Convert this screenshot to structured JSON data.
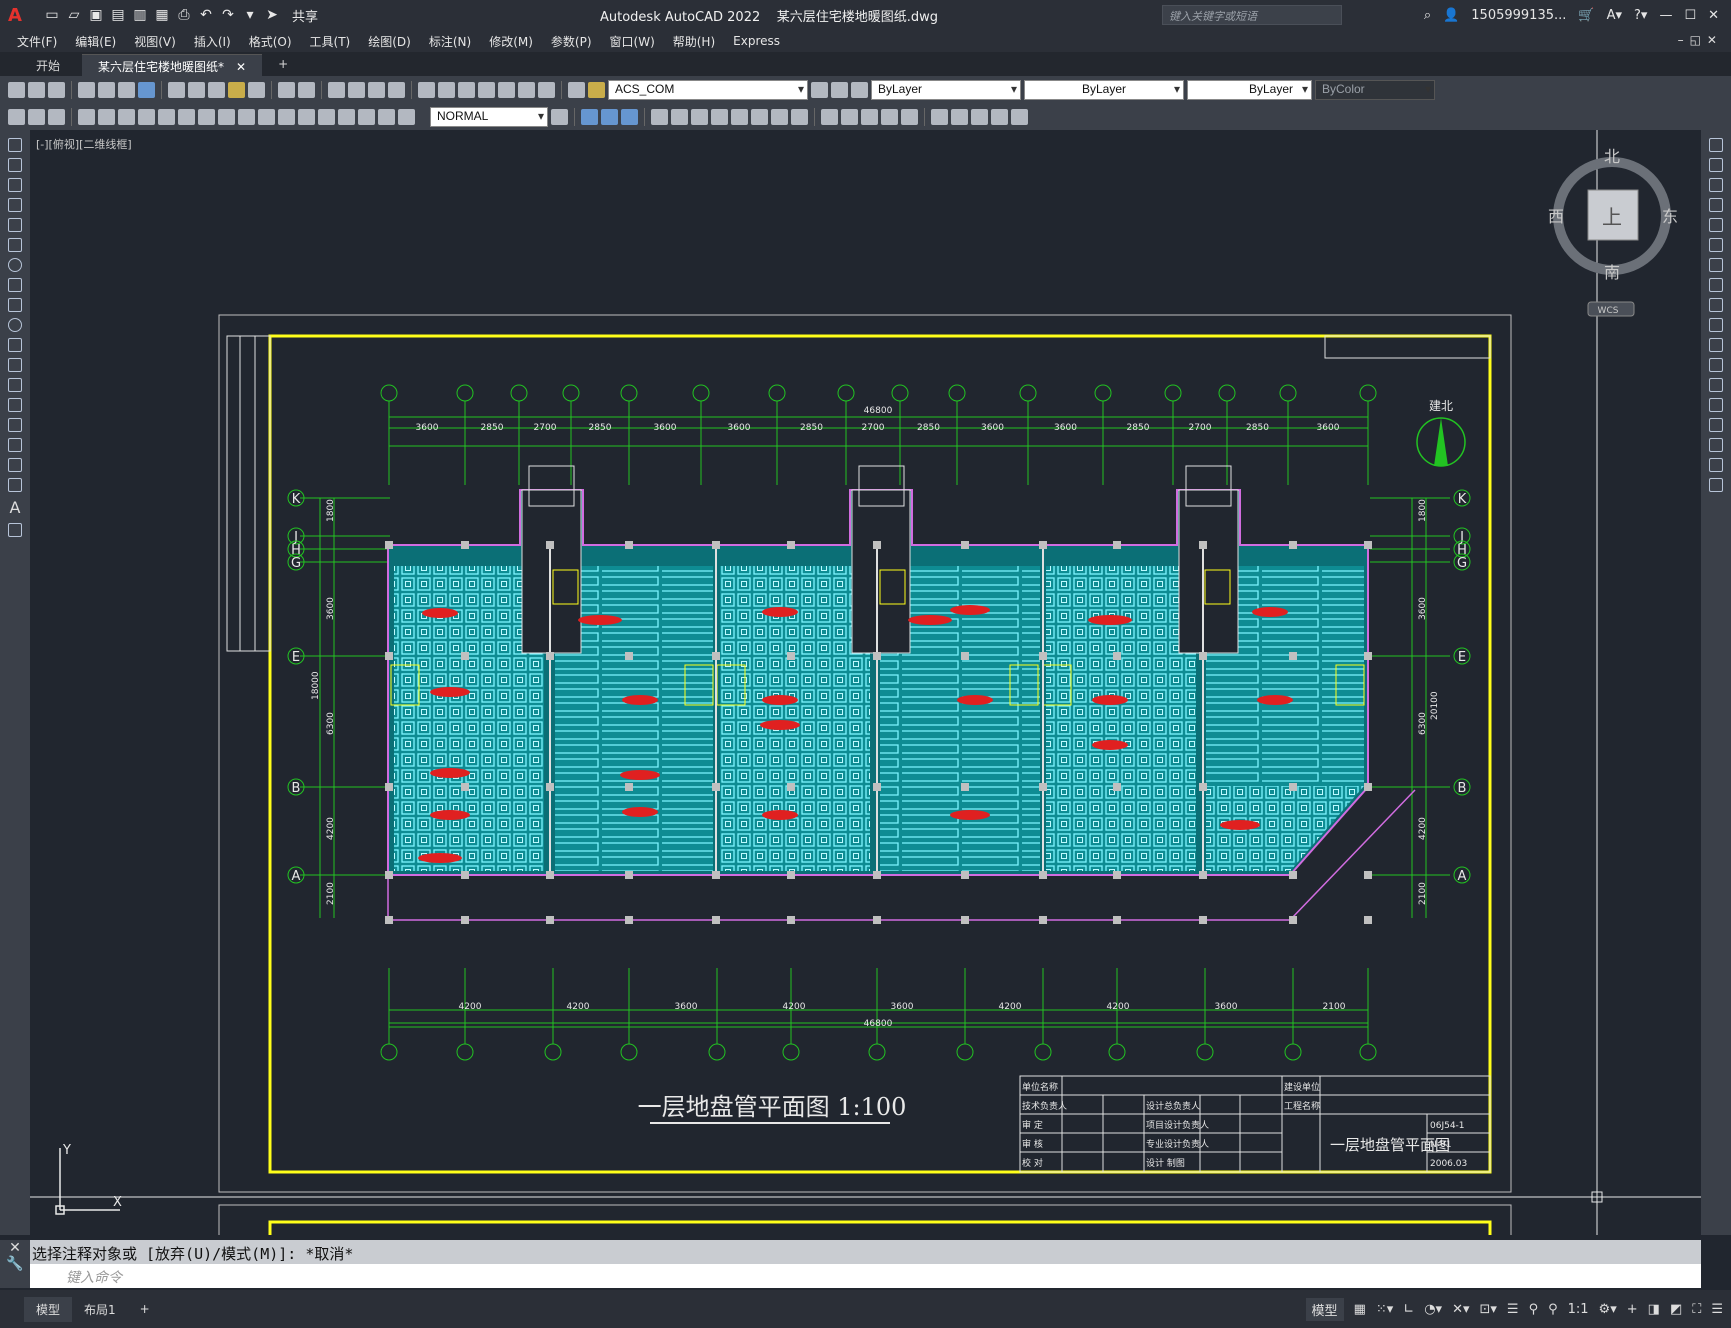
{
  "app": {
    "title": "Autodesk AutoCAD 2022",
    "file": "某六层住宅楼地暖图纸.dwg",
    "share": "共享",
    "search_placeholder": "键入关键字或短语",
    "user": "1505999135..."
  },
  "menu": [
    "文件(F)",
    "编辑(E)",
    "视图(V)",
    "插入(I)",
    "格式(O)",
    "工具(T)",
    "绘图(D)",
    "标注(N)",
    "修改(M)",
    "参数(P)",
    "窗口(W)",
    "帮助(H)",
    "Express"
  ],
  "tabs": {
    "start": "开始",
    "active": "某六层住宅楼地暖图纸*"
  },
  "toolbar": {
    "layer": "ACS_COM",
    "color": "ByLayer",
    "linetype": "ByLayer",
    "lineweight": "ByLayer",
    "plotstyle": "ByColor",
    "dimstyle": "NORMAL"
  },
  "viewport_label": "[-][俯视][二维线框]",
  "viewcube": {
    "north": "北",
    "south": "南",
    "east": "东",
    "west": "西",
    "top": "上",
    "wcs": "WCS"
  },
  "drawing": {
    "title": "一层地盘管平面图 1:100",
    "north_label": "建北",
    "overall_dim": "46800",
    "top_dims": [
      "3600",
      "2850",
      "2700",
      "2850",
      "3600",
      "3600",
      "2850",
      "2700",
      "2850",
      "3600",
      "3600",
      "2850",
      "2700",
      "2850",
      "3600"
    ],
    "bottom_dims": [
      "4200",
      "4200",
      "3600",
      "4200",
      "3600",
      "4200",
      "4200",
      "3600",
      "2100"
    ],
    "left_axes": [
      "K",
      "J",
      "H",
      "G",
      "E",
      "B",
      "A"
    ],
    "left_dims": [
      "1800",
      "3600",
      "6300",
      "4200",
      "2100",
      "18000"
    ],
    "right_dims": [
      "1800",
      "3600",
      "6300",
      "4200",
      "2100",
      "20100"
    ],
    "titleblock_rows": [
      "单位名称",
      "技术负责人",
      "审  定",
      "审  核",
      "校  对"
    ],
    "titleblock_mid": [
      "设计总负责人",
      "项目设计负责人",
      "专业设计负责人",
      "设计  制图"
    ],
    "titleblock_right": [
      "建设单位",
      "工程名称"
    ],
    "sheet_title": "一层地盘管平面图",
    "project_no": "06J54-1",
    "sheet_no": "N-01",
    "date": "2006.03"
  },
  "command": {
    "history": "选择注释对象或 [放弃(U)/模式(M)]: *取消*",
    "placeholder": "键入命令"
  },
  "status": {
    "tabs": [
      "模型",
      "布局1"
    ],
    "model": "模型",
    "scale": "1:1"
  }
}
